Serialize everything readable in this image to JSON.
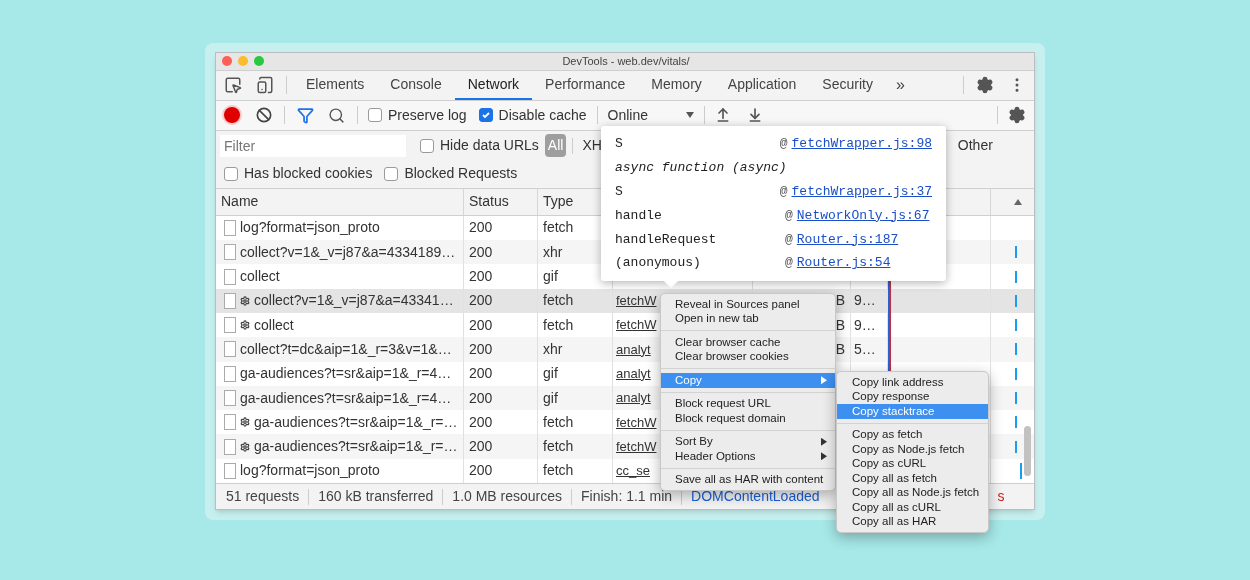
{
  "window": {
    "title": "DevTools - web.dev/vitals/"
  },
  "tabs": [
    {
      "label": "Elements",
      "selected": false
    },
    {
      "label": "Console",
      "selected": false
    },
    {
      "label": "Network",
      "selected": true
    },
    {
      "label": "Performance",
      "selected": false
    },
    {
      "label": "Memory",
      "selected": false
    },
    {
      "label": "Application",
      "selected": false
    },
    {
      "label": "Security",
      "selected": false
    }
  ],
  "more_tabs": "»",
  "toolbar": {
    "recording": true,
    "filter_active": true,
    "preserve_log": {
      "label": "Preserve log",
      "checked": false
    },
    "disable_cache": {
      "label": "Disable cache",
      "checked": true
    },
    "throttling": "Online"
  },
  "filter_bar": {
    "placeholder": "Filter",
    "hide_data_urls": {
      "label": "Hide data URLs",
      "checked": false
    },
    "types": [
      {
        "label": "All",
        "selected": true
      },
      {
        "label": "XH",
        "selected": false
      },
      {
        "label": "Other",
        "selected": false
      }
    ],
    "has_blocked_cookies": {
      "label": "Has blocked cookies",
      "checked": false
    },
    "blocked_requests": {
      "label": "Blocked Requests",
      "checked": false
    }
  },
  "table": {
    "columns": [
      "Name",
      "Status",
      "Type"
    ],
    "rows": [
      {
        "name": "log?format=json_proto",
        "service_worker": false,
        "status": "200",
        "type": "fetch",
        "selected": false,
        "timing_bar": false
      },
      {
        "name": "collect?v=1&_v=j87&a=4334189…",
        "service_worker": false,
        "status": "200",
        "type": "xhr",
        "selected": false,
        "timing_bar": true
      },
      {
        "name": "collect",
        "service_worker": false,
        "status": "200",
        "type": "gif",
        "selected": false,
        "timing_bar": true
      },
      {
        "name": "collect?v=1&_v=j87&a=43341…",
        "service_worker": true,
        "status": "200",
        "type": "fetch",
        "initiator": "fetchW",
        "size": "B",
        "time": "9…",
        "selected": true,
        "timing_bar": true
      },
      {
        "name": "collect",
        "service_worker": true,
        "status": "200",
        "type": "fetch",
        "initiator": "fetchW",
        "size": "B",
        "time": "9…",
        "selected": false,
        "timing_bar": true
      },
      {
        "name": "collect?t=dc&aip=1&_r=3&v=1&…",
        "service_worker": false,
        "status": "200",
        "type": "xhr",
        "initiator": "analyt",
        "size": "B",
        "time": "5…",
        "selected": false,
        "timing_bar": true
      },
      {
        "name": "ga-audiences?t=sr&aip=1&_r=4…",
        "service_worker": false,
        "status": "200",
        "type": "gif",
        "initiator": "analyt",
        "selected": false,
        "timing_bar": true
      },
      {
        "name": "ga-audiences?t=sr&aip=1&_r=4…",
        "service_worker": false,
        "status": "200",
        "type": "gif",
        "initiator": "analyt",
        "selected": false,
        "timing_bar": true
      },
      {
        "name": "ga-audiences?t=sr&aip=1&_r=…",
        "service_worker": true,
        "status": "200",
        "type": "fetch",
        "initiator": "fetchW",
        "selected": false,
        "timing_bar": true
      },
      {
        "name": "ga-audiences?t=sr&aip=1&_r=…",
        "service_worker": true,
        "status": "200",
        "type": "fetch",
        "initiator": "fetchW",
        "selected": false,
        "timing_bar": true
      },
      {
        "name": "log?format=json_proto",
        "service_worker": false,
        "status": "200",
        "type": "fetch",
        "initiator": "cc_se",
        "selected": false,
        "timing_bar": true
      }
    ]
  },
  "status_bar": {
    "items": [
      "51 requests",
      "160 kB transferred",
      "1.0 MB resources",
      "Finish: 1.1 min"
    ],
    "dom_content_loaded": "DOMContentLoaded",
    "load": "s"
  },
  "stack_popover": {
    "frames": [
      {
        "kind": "frame",
        "function": "S",
        "at": "@",
        "location": "fetchWrapper.js:98"
      },
      {
        "kind": "async",
        "label": "async function (async)"
      },
      {
        "kind": "frame",
        "function": "S",
        "at": "@",
        "location": "fetchWrapper.js:37"
      },
      {
        "kind": "frame",
        "function": "handle",
        "at": "@",
        "location": "NetworkOnly.js:67"
      },
      {
        "kind": "frame",
        "function": "handleRequest",
        "at": "@",
        "location": "Router.js:187"
      },
      {
        "kind": "frame",
        "function": "(anonymous)",
        "at": "@",
        "location": "Router.js:54"
      }
    ]
  },
  "context_menu": {
    "groups": [
      [
        {
          "label": "Reveal in Sources panel",
          "selected": false,
          "submenu": false
        },
        {
          "label": "Open in new tab",
          "selected": false,
          "submenu": false
        }
      ],
      [
        {
          "label": "Clear browser cache",
          "selected": false,
          "submenu": false
        },
        {
          "label": "Clear browser cookies",
          "selected": false,
          "submenu": false
        }
      ],
      [
        {
          "label": "Copy",
          "selected": true,
          "submenu": true
        }
      ],
      [
        {
          "label": "Block request URL",
          "selected": false,
          "submenu": false
        },
        {
          "label": "Block request domain",
          "selected": false,
          "submenu": false
        }
      ],
      [
        {
          "label": "Sort By",
          "selected": false,
          "submenu": true
        },
        {
          "label": "Header Options",
          "selected": false,
          "submenu": true
        }
      ],
      [
        {
          "label": "Save all as HAR with content",
          "selected": false,
          "submenu": false
        }
      ]
    ]
  },
  "copy_submenu": {
    "groups": [
      [
        {
          "label": "Copy link address",
          "selected": false
        },
        {
          "label": "Copy response",
          "selected": false
        },
        {
          "label": "Copy stacktrace",
          "selected": true
        }
      ],
      [
        {
          "label": "Copy as fetch",
          "selected": false
        },
        {
          "label": "Copy as Node.js fetch",
          "selected": false
        },
        {
          "label": "Copy as cURL",
          "selected": false
        },
        {
          "label": "Copy all as fetch",
          "selected": false
        },
        {
          "label": "Copy all as Node.js fetch",
          "selected": false
        },
        {
          "label": "Copy all as cURL",
          "selected": false
        },
        {
          "label": "Copy all as HAR",
          "selected": false
        }
      ]
    ]
  }
}
